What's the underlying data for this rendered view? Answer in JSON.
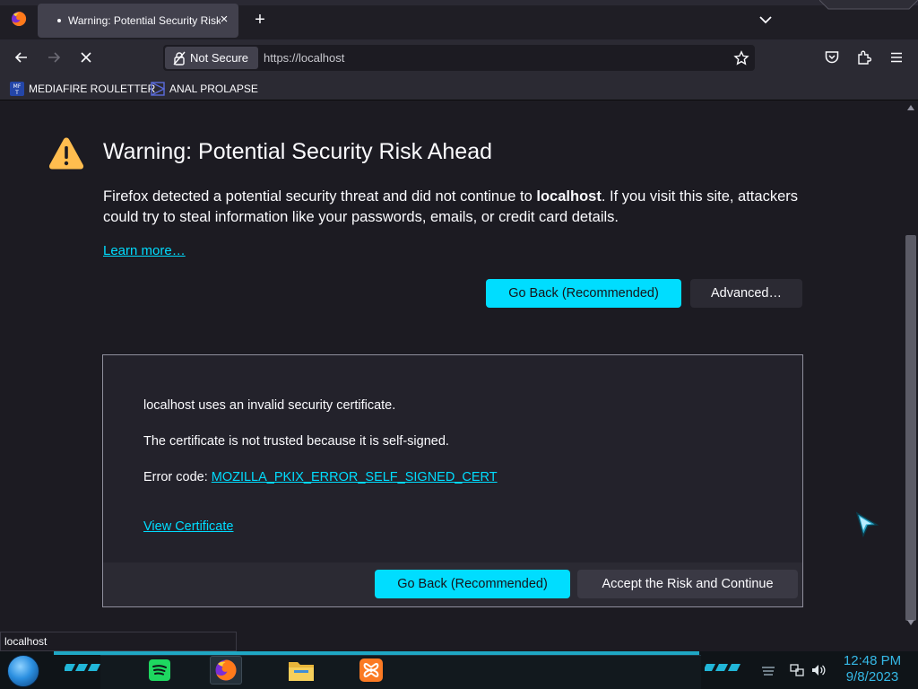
{
  "browser": {
    "tab": {
      "title": "Warning: Potential Security Risk Ahead",
      "close": "×"
    },
    "new_tab": "+",
    "urlbar": {
      "identity_label": "Not Secure",
      "url": "https://localhost"
    },
    "bookmarks": [
      {
        "label": "MEDIAFIRE ROULETTER",
        "icon": "mediafire-icon"
      },
      {
        "label": "ANAL PROLAPSE",
        "icon": "bookmark-favicon"
      }
    ]
  },
  "page": {
    "title": "Warning: Potential Security Risk Ahead",
    "intro_before": "Firefox detected a potential security threat and did not continue to ",
    "intro_host": "localhost",
    "intro_after": ". If you visit this site, attackers could try to steal information like your passwords, emails, or credit card details.",
    "learn_more": "Learn more…",
    "go_back": "Go Back (Recommended)",
    "advanced": "Advanced…"
  },
  "advanced_panel": {
    "line1": "localhost uses an invalid security certificate.",
    "line2": "The certificate is not trusted because it is self-signed.",
    "error_prefix": "Error code: ",
    "error_code": "MOZILLA_PKIX_ERROR_SELF_SIGNED_CERT",
    "view_certificate": "View Certificate",
    "go_back": "Go Back (Recommended)",
    "accept": "Accept the Risk and Continue"
  },
  "status_tooltip": "localhost",
  "taskbar": {
    "apps": [
      "spotify-icon",
      "firefox-icon",
      "file-explorer-icon",
      "xampp-icon"
    ],
    "clock": {
      "time": "12:48 PM",
      "date": "9/8/2023"
    }
  },
  "colors": {
    "accent": "#00ddff",
    "page_background": "#1c1b22",
    "warning": "#ffbd4f",
    "taskbar_accent": "#35b9e6"
  }
}
